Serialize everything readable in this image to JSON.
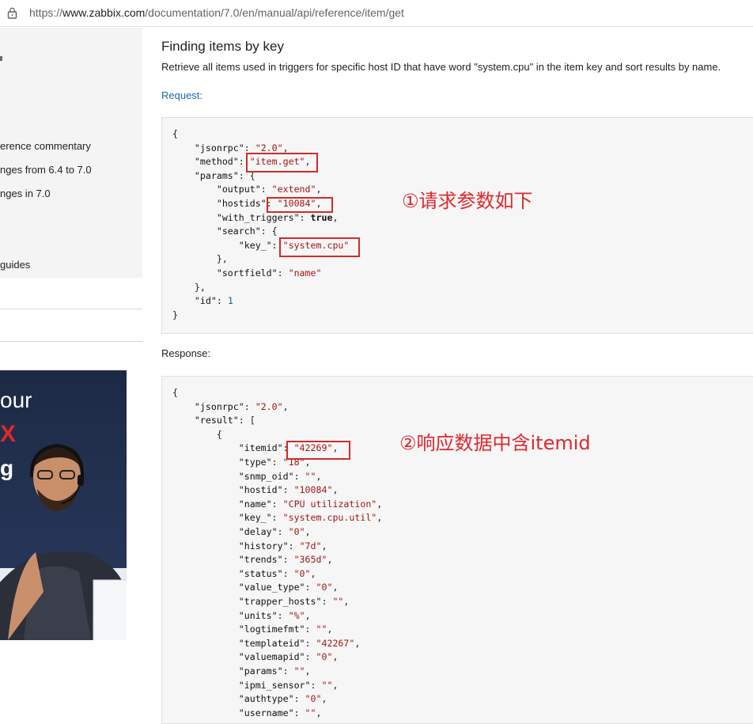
{
  "browser": {
    "url_prefix": "https://",
    "url_host": "www.zabbix.com",
    "url_path": "/documentation/7.0/en/manual/api/reference/item/get"
  },
  "sidebar": {
    "items": [
      {
        "label": "erence commentary"
      },
      {
        "label": "nges from 6.4 to 7.0"
      },
      {
        "label": "nges in 7.0"
      },
      {
        "label": "guides"
      }
    ]
  },
  "ad": {
    "line1": "our",
    "line2": "X",
    "line3": "g"
  },
  "main": {
    "heading": "Finding items by key",
    "description": "Retrieve all items used in triggers for specific host ID that have word \"system.cpu\" in the item key and sort results by name.",
    "request_label": "Request:",
    "response_label": "Response:"
  },
  "request_lines": [
    "{",
    "    \"jsonrpc\": \"2.0\",",
    "    \"method\": \"item.get\",",
    "    \"params\": {",
    "        \"output\": \"extend\",",
    "        \"hostids\": \"10084\",",
    "        \"with_triggers\": true,",
    "        \"search\": {",
    "            \"key_\": \"system.cpu\"",
    "        },",
    "        \"sortfield\": \"name\"",
    "    },",
    "    \"id\": 1",
    "}"
  ],
  "response_lines": [
    "{",
    "    \"jsonrpc\": \"2.0\",",
    "    \"result\": [",
    "        {",
    "            \"itemid\": \"42269\",",
    "            \"type\": \"18\",",
    "            \"snmp_oid\": \"\",",
    "            \"hostid\": \"10084\",",
    "            \"name\": \"CPU utilization\",",
    "            \"key_\": \"system.cpu.util\",",
    "            \"delay\": \"0\",",
    "            \"history\": \"7d\",",
    "            \"trends\": \"365d\",",
    "            \"status\": \"0\",",
    "            \"value_type\": \"0\",",
    "            \"trapper_hosts\": \"\",",
    "            \"units\": \"%\",",
    "            \"logtimefmt\": \"\",",
    "            \"templateid\": \"42267\",",
    "            \"valuemapid\": \"0\",",
    "            \"params\": \"\",",
    "            \"ipmi_sensor\": \"\",",
    "            \"authtype\": \"0\",",
    "            \"username\": \"\","
  ],
  "annotations": {
    "request_note": "①请求参数如下",
    "response_note": "②响应数据中含itemid"
  },
  "colors": {
    "annotation_red": "#e0282e",
    "link_blue": "#1a6bb0",
    "string_red": "#a31515",
    "number_blue": "#0b5fb3"
  }
}
